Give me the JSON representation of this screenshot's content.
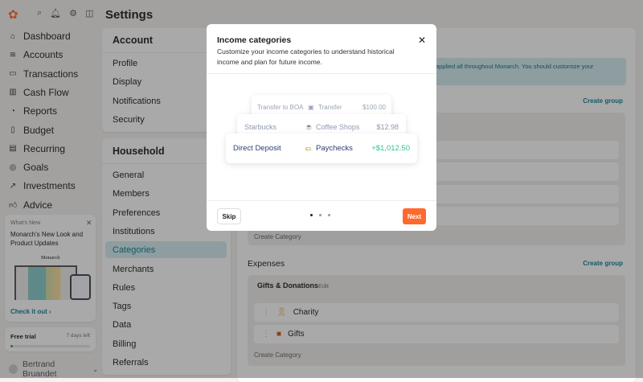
{
  "header": {
    "title": "Settings"
  },
  "sidebar": {
    "items": [
      {
        "label": "Dashboard",
        "icon": "home-icon"
      },
      {
        "label": "Accounts",
        "icon": "layers-icon"
      },
      {
        "label": "Transactions",
        "icon": "credit-card-icon"
      },
      {
        "label": "Cash Flow",
        "icon": "bar-chart-icon"
      },
      {
        "label": "Reports",
        "icon": "pie-chart-icon"
      },
      {
        "label": "Budget",
        "icon": "map-icon"
      },
      {
        "label": "Recurring",
        "icon": "calendar-icon"
      },
      {
        "label": "Goals",
        "icon": "target-icon"
      },
      {
        "label": "Investments",
        "icon": "trend-up-icon"
      },
      {
        "label": "Advice",
        "icon": "thumbs-up-icon"
      }
    ],
    "whats_new": {
      "label": "What's New",
      "title": "Monarch's New Look and Product Updates",
      "logo_text": "Monarch",
      "link": "Check it out ›"
    },
    "trial": {
      "label": "Free trial",
      "days": "7 days left",
      "progress": 0.03
    },
    "user": "Bertrand Bruandet"
  },
  "settings_menu": {
    "account_heading": "Account",
    "account_items": [
      "Profile",
      "Display",
      "Notifications",
      "Security"
    ],
    "household_heading": "Household",
    "household_items": [
      "General",
      "Members",
      "Preferences",
      "Institutions",
      "Categories",
      "Merchants",
      "Rules",
      "Tags",
      "Data",
      "Billing",
      "Referrals"
    ],
    "selected": "Categories"
  },
  "main": {
    "banner": "applied all throughout Monarch. You should customize your",
    "create_group": "Create group",
    "create_category": "Create Category",
    "expenses_heading": "Expenses",
    "group": {
      "name": "Gifts & Donations",
      "edit": "Edit",
      "items": [
        "Charity",
        "Gifts"
      ]
    }
  },
  "modal": {
    "title": "Income categories",
    "description": "Customize your income categories to understand historical income and plan for future income.",
    "transactions": [
      {
        "name": "Transfer to BOA",
        "category": "Transfer",
        "amount": "$100.00"
      },
      {
        "name": "Starbucks",
        "category": "Coffee Shops",
        "amount": "$12.98"
      },
      {
        "name": "Direct Deposit",
        "category": "Paychecks",
        "amount": "+$1,012.50"
      }
    ],
    "skip": "Skip",
    "next": "Next",
    "step": 1,
    "steps": 3
  },
  "colors": {
    "accent": "#ff692d",
    "income": "#2fc58c",
    "link": "#0f7f94"
  }
}
